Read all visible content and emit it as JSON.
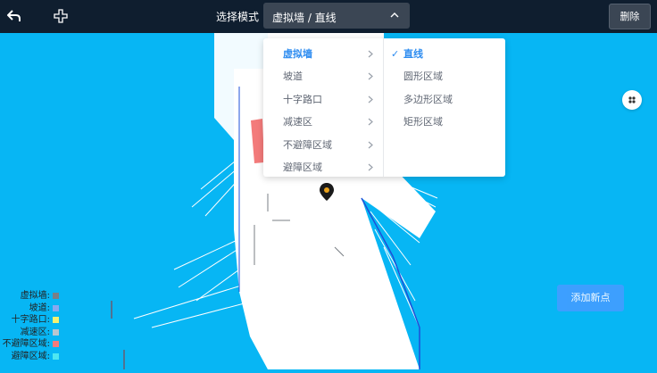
{
  "header": {
    "mode_label": "选择模式",
    "mode_value": "虚拟墙 / 直线",
    "delete_label": "删除"
  },
  "dropdown": {
    "categories": [
      {
        "label": "虚拟墙",
        "active": true
      },
      {
        "label": "坡道"
      },
      {
        "label": "十字路口"
      },
      {
        "label": "减速区"
      },
      {
        "label": "不避障区域"
      },
      {
        "label": "避障区域"
      }
    ],
    "shapes": [
      {
        "label": "直线",
        "active": true
      },
      {
        "label": "圆形区域"
      },
      {
        "label": "多边形区域"
      },
      {
        "label": "矩形区域"
      }
    ]
  },
  "actions": {
    "add_point_label": "添加新点"
  },
  "legend": [
    {
      "label": "虚拟墙:",
      "color": "#7a7f86"
    },
    {
      "label": "坡道:",
      "color": "#8aa8ef"
    },
    {
      "label": "十字路口:",
      "color": "#f4f171"
    },
    {
      "label": "减速区:",
      "color": "#b9c6cf"
    },
    {
      "label": "不避障区域:",
      "color": "#f37b7b"
    },
    {
      "label": "避障区域:",
      "color": "#4ee7f1"
    }
  ],
  "colors": {
    "topbar": "#0f1e2f",
    "map_bg": "#07b6f4",
    "accent": "#2d8cf0",
    "no_avoid_zone": "#f37b7b",
    "pin": "#e9a11b"
  },
  "icons": [
    "back-arrow-icon",
    "cross-plus-icon",
    "chevron-up-icon",
    "grid-dots-icon",
    "map-pin-icon",
    "checkmark-icon",
    "chevron-right-icon"
  ]
}
